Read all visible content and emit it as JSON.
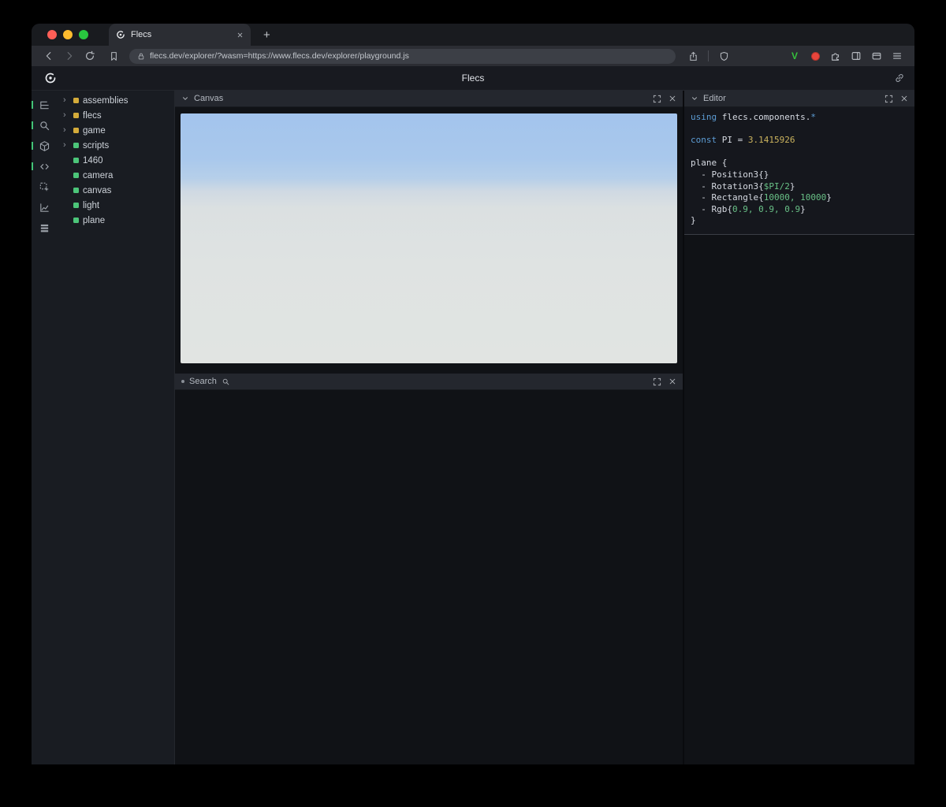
{
  "browser": {
    "tab_title": "Flecs",
    "url": "flecs.dev/explorer/?wasm=https://www.flecs.dev/explorer/playground.js"
  },
  "header": {
    "title": "Flecs"
  },
  "tree": {
    "items": [
      {
        "label": "assemblies",
        "arrow": true,
        "color": "#d4ab3a"
      },
      {
        "label": "flecs",
        "arrow": true,
        "color": "#d4ab3a"
      },
      {
        "label": "game",
        "arrow": true,
        "color": "#d4ab3a"
      },
      {
        "label": "scripts",
        "arrow": true,
        "color": "#4cc579"
      },
      {
        "label": "1460",
        "arrow": false,
        "color": "#4cc579"
      },
      {
        "label": "camera",
        "arrow": false,
        "color": "#4cc579"
      },
      {
        "label": "canvas",
        "arrow": false,
        "color": "#4cc579"
      },
      {
        "label": "light",
        "arrow": false,
        "color": "#4cc579"
      },
      {
        "label": "plane",
        "arrow": false,
        "color": "#4cc579"
      }
    ]
  },
  "canvas_panel": {
    "title": "Canvas"
  },
  "search_panel": {
    "title": "Search"
  },
  "editor_panel": {
    "title": "Editor",
    "lines": [
      [
        {
          "t": "using ",
          "c": "kw"
        },
        {
          "t": "flecs.components.",
          "c": "id"
        },
        {
          "t": "*",
          "c": "kw"
        }
      ],
      [],
      [
        {
          "t": "const ",
          "c": "kw"
        },
        {
          "t": "PI = ",
          "c": "id"
        },
        {
          "t": "3.1415926",
          "c": "num"
        }
      ],
      [],
      [
        {
          "t": "plane {",
          "c": "id"
        }
      ],
      [
        {
          "t": "  - Position3{}",
          "c": "id"
        }
      ],
      [
        {
          "t": "  - Rotation3{",
          "c": "id"
        },
        {
          "t": "$PI/2",
          "c": "val"
        },
        {
          "t": "}",
          "c": "id"
        }
      ],
      [
        {
          "t": "  - Rectangle{",
          "c": "id"
        },
        {
          "t": "10000, 10000",
          "c": "val"
        },
        {
          "t": "}",
          "c": "id"
        }
      ],
      [
        {
          "t": "  - Rgb{",
          "c": "id"
        },
        {
          "t": "0.9, 0.9, 0.9",
          "c": "val"
        },
        {
          "t": "}",
          "c": "id"
        }
      ],
      [
        {
          "t": "}",
          "c": "id"
        }
      ]
    ]
  },
  "colors": {
    "entity_yellow": "#d4ab3a",
    "entity_green": "#4cc579",
    "keyword_blue": "#5d9dd5",
    "number_yellow": "#ccb45e",
    "value_green": "#69c187",
    "sky_top": "#a3c4ed",
    "ground_gray": "#e1e4e2",
    "rail_active_green": "#43c478"
  }
}
